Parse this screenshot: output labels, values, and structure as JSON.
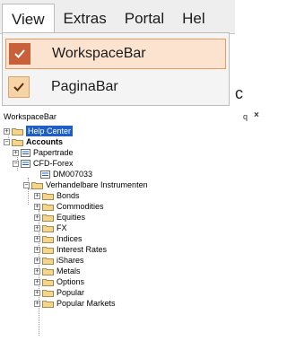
{
  "menu": {
    "titles": [
      "View",
      "Extras",
      "Portal",
      "Hel"
    ],
    "items": [
      {
        "label": "WorkspaceBar",
        "checked": true,
        "highlighted": true
      },
      {
        "label": "PaginaBar",
        "checked": true,
        "highlighted": false
      }
    ],
    "stray_text": "c"
  },
  "panel": {
    "title": "WorkspaceBar",
    "pin_glyph": "q",
    "close_glyph": "×"
  },
  "tree": {
    "help_center": "Help Center",
    "accounts": "Accounts",
    "papertrade": "Papertrade",
    "cfd_forex": "CFD-Forex",
    "account_id": "DM007033",
    "instruments_folder": "Verhandelbare Instrumenten",
    "instruments": [
      "Bonds",
      "Commodities",
      "Equities",
      "FX",
      "Indices",
      "Interest Rates",
      "iShares",
      "Metals",
      "Options",
      "Popular",
      "Popular Markets"
    ]
  },
  "colors": {
    "highlight_bg": "#fbe3cf",
    "highlight_border": "#e59a5e",
    "check_active": "#c8603a",
    "selection": "#1e5fc5"
  }
}
